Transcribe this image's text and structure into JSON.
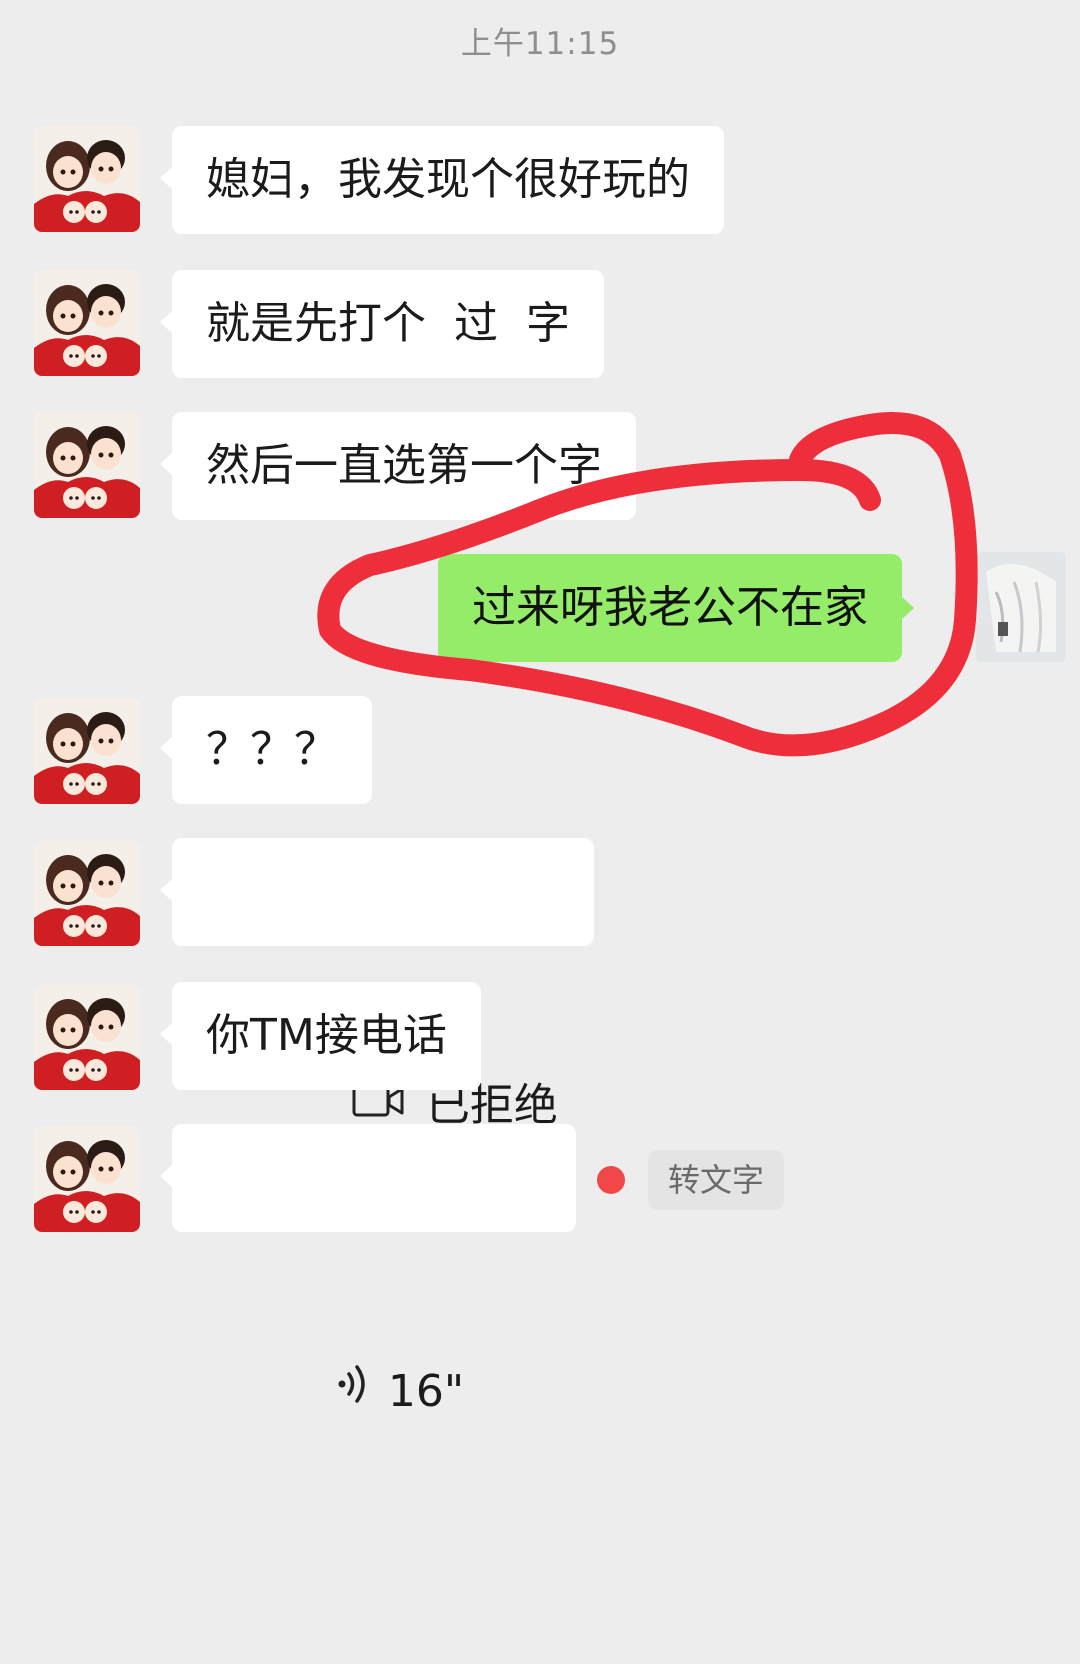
{
  "timestamp": "上午11:15",
  "messages": [
    {
      "text": "媳妇，我发现个很好玩的"
    },
    {
      "text": "就是先打个  过  字"
    },
    {
      "text": "然后一直选第一个字"
    },
    {
      "text": "过来呀我老公不在家"
    },
    {
      "text": "？？？"
    },
    {
      "text": "已拒绝",
      "icon": "video-call-icon"
    },
    {
      "text": "你TM接电话"
    },
    {
      "text": "16\"",
      "icon": "voice-wave-icon",
      "unread": true
    }
  ],
  "voice_actions": {
    "to_text_label": "转文字"
  },
  "colors": {
    "background": "#ededed",
    "incoming_bubble": "#ffffff",
    "outgoing_bubble": "#95ec69",
    "annotation_stroke": "#ee2f3b",
    "unread_dot": "#f04848"
  }
}
